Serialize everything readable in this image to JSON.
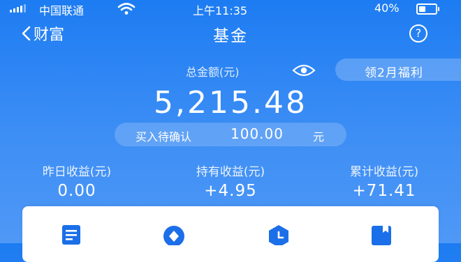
{
  "status_bar": {
    "carrier": "中国联通",
    "time": "上午11:35",
    "battery": "40%",
    "battery_level": 0.4,
    "signal_icon": "signal-bars-icon",
    "wifi_icon": "wifi-icon"
  },
  "nav": {
    "back_label": "财富",
    "title": "基金",
    "help_icon": "question-circle-icon"
  },
  "summary": {
    "total_label": "总金额(元)",
    "total_amount": "5,215.48",
    "promo_label": "领2月福利",
    "pending_label": "买入待确认",
    "pending_value": "100.00",
    "pending_unit": "元"
  },
  "stats": [
    {
      "label": "昨日收益(元)",
      "value": "0.00"
    },
    {
      "label": "持有收益(元)",
      "value": "+4.95"
    },
    {
      "label": "累计收益(元)",
      "value": "+71.41"
    }
  ],
  "menu_icons": [
    "document-icon",
    "diamond-icon",
    "clock-icon",
    "bookmark-icon"
  ],
  "colors": {
    "background": "#1d7cf2",
    "icon_blue": "#1b6fe8"
  }
}
